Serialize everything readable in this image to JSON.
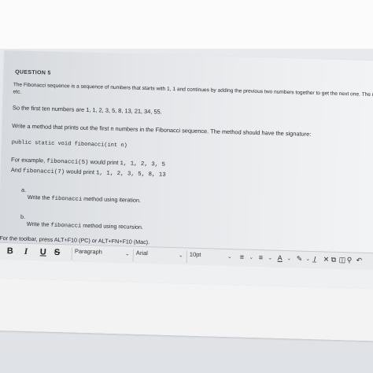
{
  "question": {
    "title": "QUESTION 5",
    "intro_line1": "The Fibonacci sequence is a sequence of numbers that starts with 1, 1 and continues by adding the previous two numbers together to get the next one. The next numbers in the sequence are",
    "intro_line2": "etc.",
    "first_ten": "So the first ten numbers are 1, 1, 2, 3, 5, 8, 13, 21, 34, 55.",
    "task": "Write a method that prints out the first n numbers in the Fibonacci sequence. The method should have the signature:",
    "signature": "public static void fibonacci(int n)",
    "example_prefix": "For example,",
    "example1_call": "fibonacci(5)",
    "example1_text": "would print",
    "example1_output": "1, 1, 2, 3, 5",
    "example2_prefix": "And",
    "example2_call": "fibonacci(7)",
    "example2_text": "would print",
    "example2_output": "1, 1, 2, 3, 5, 8, 13",
    "parts": [
      {
        "label": "a.",
        "before": "Write the",
        "code": "fibonacci",
        "after": "method using iteration."
      },
      {
        "label": "b.",
        "before": "Write the",
        "code": "fibonacci",
        "after": "method using recursion."
      }
    ]
  },
  "editor": {
    "toolbar_hint": "For the toolbar, press ALT+F10 (PC) or ALT+FN+F10 (Mac).",
    "bold": "B",
    "italic": "I",
    "underline": "U",
    "strike": "S",
    "paragraph": "Paragraph",
    "font": "Arial",
    "size": "10pt",
    "icons": [
      "bullet-list-icon",
      "numbered-list-icon",
      "text-color-icon",
      "highlight-icon",
      "clear-format-icon",
      "cut-icon",
      "copy-icon",
      "paste-icon",
      "search-icon",
      "undo-icon"
    ]
  }
}
